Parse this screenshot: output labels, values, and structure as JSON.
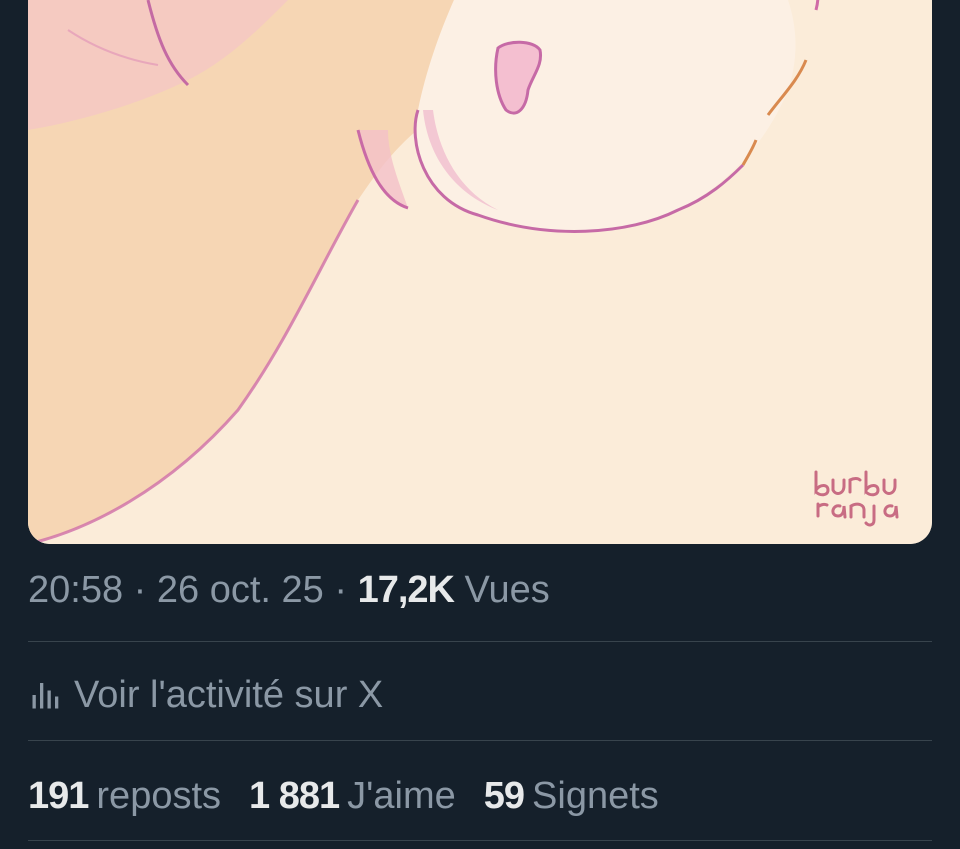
{
  "post": {
    "image_signature": "burbu ranja",
    "time": "20:58",
    "separator": "·",
    "date": "26 oct. 25",
    "views_count": "17,2K",
    "views_label": "Vues"
  },
  "activity": {
    "icon": "analytics-icon",
    "label": "Voir l'activité sur X"
  },
  "stats": {
    "reposts_count": "191",
    "reposts_label": "reposts",
    "likes_count": "1 881",
    "likes_label": "J'aime",
    "bookmarks_count": "59",
    "bookmarks_label": "Signets"
  },
  "colors": {
    "background": "#15202b",
    "text_primary": "#e7e9ea",
    "text_secondary": "#8b98a5",
    "divider": "#38444d"
  }
}
